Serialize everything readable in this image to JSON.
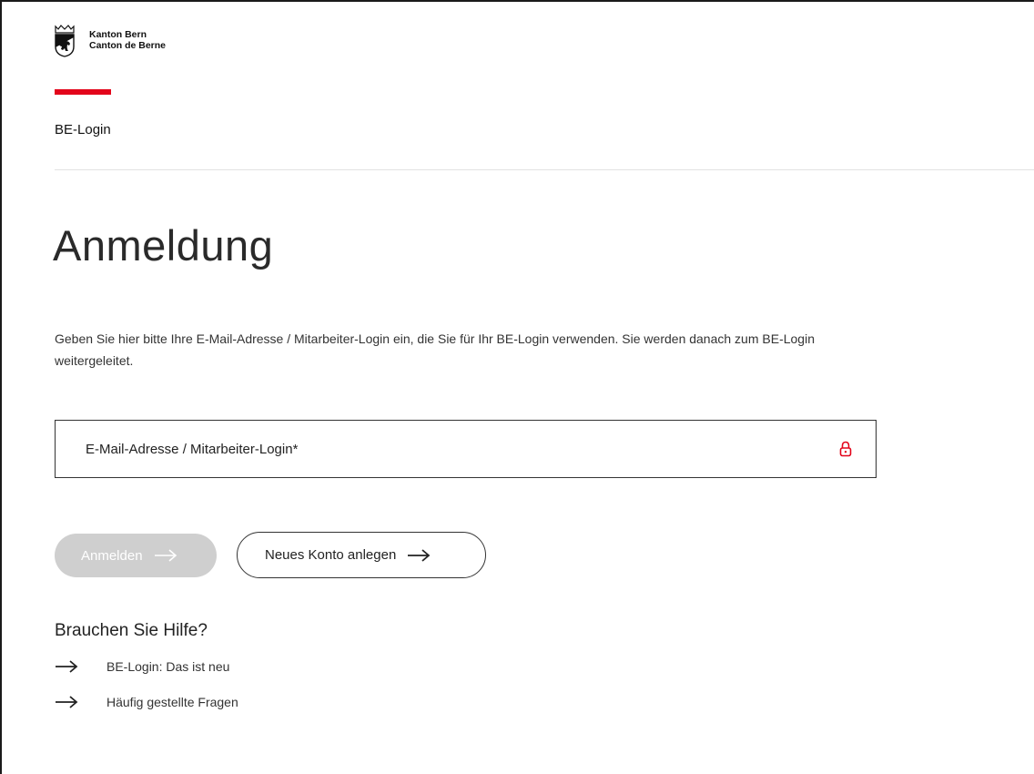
{
  "header": {
    "canton_line1": "Kanton Bern",
    "canton_line2": "Canton de Berne",
    "service_name": "BE-Login",
    "brand_color": "#e3051b"
  },
  "main": {
    "title": "Anmeldung",
    "intro": "Geben Sie hier bitte Ihre E-Mail-Adresse / Mitarbeiter-Login ein, die Sie für Ihr BE-Login verwenden. Sie werden danach zum BE-Login weitergeleitet.",
    "email_field": {
      "placeholder": "E-Mail-Adresse / Mitarbeiter-Login*",
      "value": "",
      "icon": "lock-icon"
    },
    "buttons": {
      "login_label": "Anmelden",
      "register_label": "Neues Konto anlegen"
    }
  },
  "help": {
    "title": "Brauchen Sie Hilfe?",
    "links": [
      {
        "label": "BE-Login: Das ist neu",
        "icon": "arrow-right-icon"
      },
      {
        "label": "Häufig gestellte Fragen",
        "icon": "arrow-right-icon"
      }
    ]
  },
  "colors": {
    "disabled_button": "#cfcfcf",
    "text": "#222222",
    "icon_accent": "#e3051b"
  }
}
